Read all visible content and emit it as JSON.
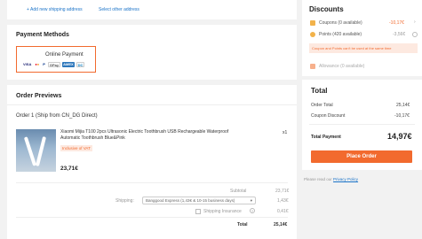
{
  "address": {
    "add_new": "+ Add new shipping address",
    "select_other": "Select other address"
  },
  "payment": {
    "title": "Payment Methods",
    "online": "Online Payment",
    "cards": [
      "VISA",
      "MC",
      "P",
      "GPay",
      "AMEX",
      "DC"
    ]
  },
  "orders": {
    "title": "Order Previews",
    "order1": "Order 1 (Ship from CN_DG Direct)",
    "product_name": "Xiaomi Mijia T100 2pcs Ultrasonic Electric Toothbrush USB Rechargeable Waterproof Automatic Toothbrush Blue&Pink",
    "qty": "x1",
    "vat_tag": "Inclusive of VAT",
    "price": "23,71€",
    "subtotal_label": "Subtotal",
    "subtotal_value": "23,71€",
    "shipping_label": "Shipping:",
    "shipping_option": "Banggood Express (1,43€ & 10-15 business days)",
    "shipping_value": "1,43€",
    "insurance_label": "Shipping Insurance",
    "insurance_value": "0,41€",
    "total_label": "Total",
    "total_value": "25,14€"
  },
  "discounts": {
    "title": "Discounts",
    "coupons": "Coupons (0 available)",
    "coupons_value": "-10,17€",
    "points": "Points (420 available)",
    "points_value": "-3,56€",
    "warning": "Coupon and Points can't be used at the same time",
    "allowance": "Allowance (0 available)"
  },
  "totals": {
    "title": "Total",
    "order_total_label": "Order Total",
    "order_total_value": "25,14€",
    "coupon_discount_label": "Coupon Discount",
    "coupon_discount_value": "-10,17€",
    "total_payment_label": "Total Payment",
    "total_payment_value": "14,97€",
    "place_order": "Place Order",
    "policy_prefix": "Please read our",
    "policy_link": "Privacy Policy"
  },
  "colors": {
    "accent": "#f26a2e",
    "link": "#1a73c8"
  }
}
